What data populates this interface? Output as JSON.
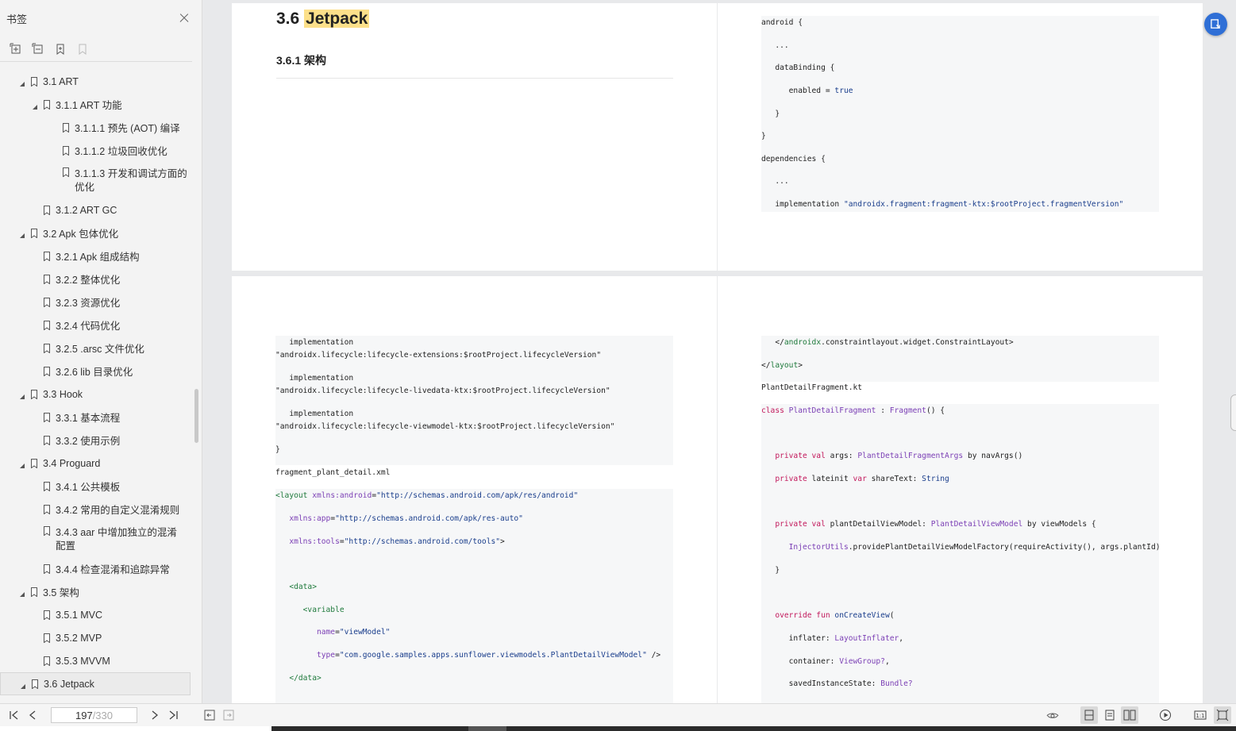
{
  "sidebar": {
    "title": "书签",
    "items": [
      {
        "label": "3.1 ART",
        "level": 1,
        "expanded": true
      },
      {
        "label": "3.1.1 ART 功能",
        "level": 2,
        "expanded": true
      },
      {
        "label": "3.1.1.1 预先 (AOT) 编译",
        "level": 3
      },
      {
        "label": "3.1.1.2 垃圾回收优化",
        "level": 3
      },
      {
        "label": "3.1.1.3 开发和调试方面的优化",
        "level": 3
      },
      {
        "label": "3.1.2 ART GC",
        "level": 2
      },
      {
        "label": "3.2 Apk 包体优化",
        "level": 1,
        "expanded": true
      },
      {
        "label": "3.2.1 Apk 组成结构",
        "level": 2
      },
      {
        "label": "3.2.2 整体优化",
        "level": 2
      },
      {
        "label": "3.2.3 资源优化",
        "level": 2
      },
      {
        "label": "3.2.4 代码优化",
        "level": 2
      },
      {
        "label": "3.2.5 .arsc 文件优化",
        "level": 2
      },
      {
        "label": "3.2.6 lib 目录优化",
        "level": 2
      },
      {
        "label": "3.3 Hook",
        "level": 1,
        "expanded": true
      },
      {
        "label": "3.3.1 基本流程",
        "level": 2
      },
      {
        "label": "3.3.2 使用示例",
        "level": 2
      },
      {
        "label": "3.4 Proguard",
        "level": 1,
        "expanded": true
      },
      {
        "label": "3.4.1 公共模板",
        "level": 2
      },
      {
        "label": "3.4.2 常用的自定义混淆规则",
        "level": 2
      },
      {
        "label": "3.4.3 aar 中增加独立的混淆配置",
        "level": 2
      },
      {
        "label": "3.4.4 检查混淆和追踪异常",
        "level": 2
      },
      {
        "label": "3.5 架构",
        "level": 1,
        "expanded": true
      },
      {
        "label": "3.5.1 MVC",
        "level": 2
      },
      {
        "label": "3.5.2 MVP",
        "level": 2
      },
      {
        "label": "3.5.3 MVVM",
        "level": 2
      },
      {
        "label": "3.6 Jetpack",
        "level": 1,
        "expanded": true,
        "selected": true
      }
    ]
  },
  "page1": {
    "section_num": "3.6",
    "section_title": "Jetpack",
    "subsection": "3.6.1  架构"
  },
  "page2": {
    "lines": [
      "android {",
      "   ...",
      "   dataBinding {",
      "      enabled = true",
      "   }",
      "}",
      "dependencies {",
      "   ...",
      "   implementation \"androidx.fragment:fragment-ktx:$rootProject.fragmentVersion\""
    ]
  },
  "page3": {
    "block1": [
      "   implementation",
      "\"androidx.lifecycle:lifecycle-extensions:$rootProject.lifecycleVersion\"",
      "   implementation",
      "\"androidx.lifecycle:lifecycle-livedata-ktx:$rootProject.lifecycleVersion\"",
      "   implementation",
      "\"androidx.lifecycle:lifecycle-viewmodel-ktx:$rootProject.lifecycleVersion\"",
      "}"
    ],
    "filename": "fragment_plant_detail.xml",
    "block2": [
      "<layout xmlns:android=\"http://schemas.android.com/apk/res/android\"",
      "   xmlns:app=\"http://schemas.android.com/apk/res-auto\"",
      "   xmlns:tools=\"http://schemas.android.com/tools\">",
      "   <data>",
      "      <variable",
      "         name=\"viewModel\"",
      "         type=\"com.google.samples.apps.sunflower.viewmodels.PlantDetailViewModel\" />",
      "   </data>"
    ]
  },
  "page4": {
    "block1": [
      "   </androidx.constraintlayout.widget.ConstraintLayout>",
      "</layout>"
    ],
    "filename": "PlantDetailFragment.kt",
    "block2": [
      "class PlantDetailFragment : Fragment() {",
      "   private val args: PlantDetailFragmentArgs by navArgs()",
      "   private lateinit var shareText: String",
      "   private val plantDetailViewModel: PlantDetailViewModel by viewModels {",
      "      InjectorUtils.providePlantDetailViewModelFactory(requireActivity(), args.plantId)",
      "   }",
      "   override fun onCreateView(",
      "      inflater: LayoutInflater,",
      "      container: ViewGroup?,",
      "      savedInstanceState: Bundle?"
    ]
  },
  "bottombar": {
    "current_page": "197",
    "total_pages": "/330"
  },
  "colors": {
    "highlight": "#fce08a",
    "accent_button": "#2f6fd6",
    "keyword": "#c2185b",
    "type": "#7b3fb5",
    "string": "#1a3e8c",
    "xml_tag": "#1f7a3c"
  }
}
